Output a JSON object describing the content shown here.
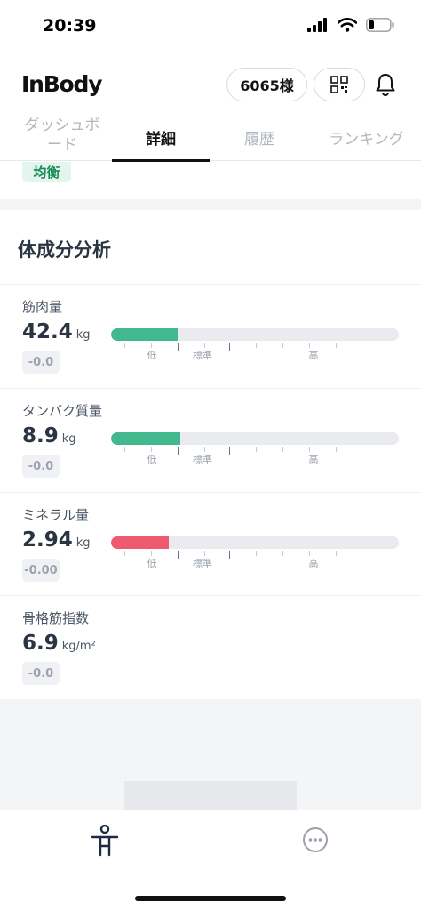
{
  "status_bar": {
    "time": "20:39"
  },
  "header": {
    "logo": "InBody",
    "user_label": "6065様"
  },
  "tabs": [
    {
      "line1": "ダッシュボ",
      "line2": "ード"
    },
    {
      "label": "詳細"
    },
    {
      "label": "履歴"
    },
    {
      "label": "ランキング"
    }
  ],
  "balance_badge": "均衡",
  "section": {
    "title": "体成分分析"
  },
  "metrics": [
    {
      "label": "筋肉量",
      "value": "42.4",
      "unit": "kg",
      "change": "-0.0",
      "level": 0.23,
      "color": "#42b88f",
      "scale": [
        "低",
        "標準",
        "高"
      ]
    },
    {
      "label": "タンパク質量",
      "value": "8.9",
      "unit": "kg",
      "change": "-0.0",
      "level": 0.24,
      "color": "#42b88f",
      "scale": [
        "低",
        "標準",
        "高"
      ]
    },
    {
      "label": "ミネラル量",
      "value": "2.94",
      "unit": "kg",
      "change": "-0.00",
      "level": 0.2,
      "color": "#ef5a6f",
      "scale": [
        "低",
        "標準",
        "高"
      ]
    },
    {
      "label": "骨格筋指数",
      "value": "6.9",
      "unit": "kg/m²",
      "change": "-0.0"
    }
  ],
  "icons": {
    "signal": "cellular-signal-icon",
    "wifi": "wifi-icon",
    "battery": "battery-icon",
    "qr": "qr-code-icon",
    "bell": "bell-icon",
    "body": "body-icon",
    "more": "more-icon"
  }
}
